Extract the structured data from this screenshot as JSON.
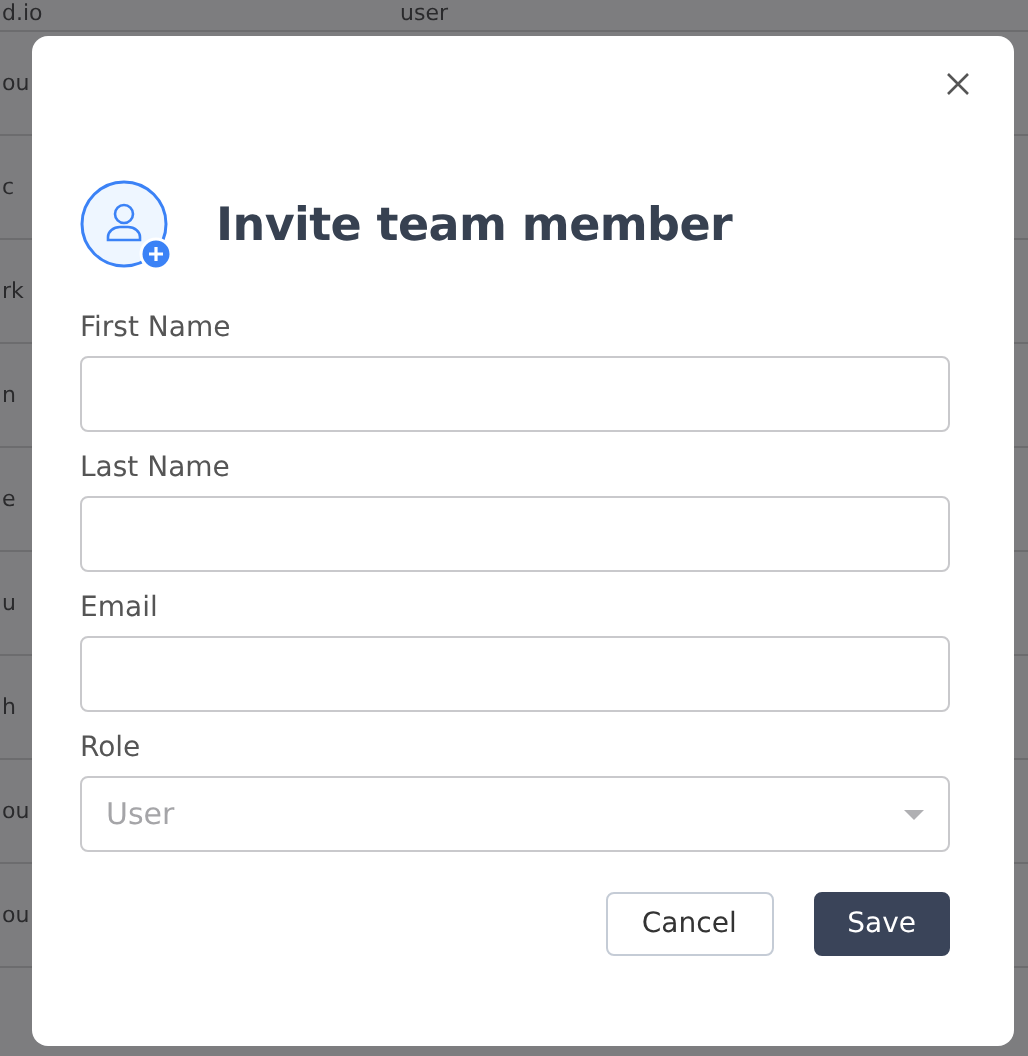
{
  "background_table": {
    "rows": [
      {
        "column_1": "d.io",
        "column_2": "user"
      },
      {
        "column_1": "ou"
      },
      {
        "column_1": "c"
      },
      {
        "column_1": "rk"
      },
      {
        "column_1": "n"
      },
      {
        "column_1": "e"
      },
      {
        "column_1": "u"
      },
      {
        "column_1": "h"
      },
      {
        "column_1": "ou"
      },
      {
        "column_1": "ou"
      }
    ]
  },
  "dialog": {
    "title": "Invite team member",
    "fields": [
      {
        "kind": "text",
        "label": "First Name"
      },
      {
        "kind": "text",
        "label": "Last Name"
      },
      {
        "kind": "text",
        "label": "Email"
      },
      {
        "kind": "select",
        "label": "Role",
        "placeholder": "User"
      }
    ],
    "buttons": [
      {
        "kind": "secondary",
        "label": "Cancel"
      },
      {
        "kind": "primary",
        "label": "Save"
      }
    ]
  }
}
